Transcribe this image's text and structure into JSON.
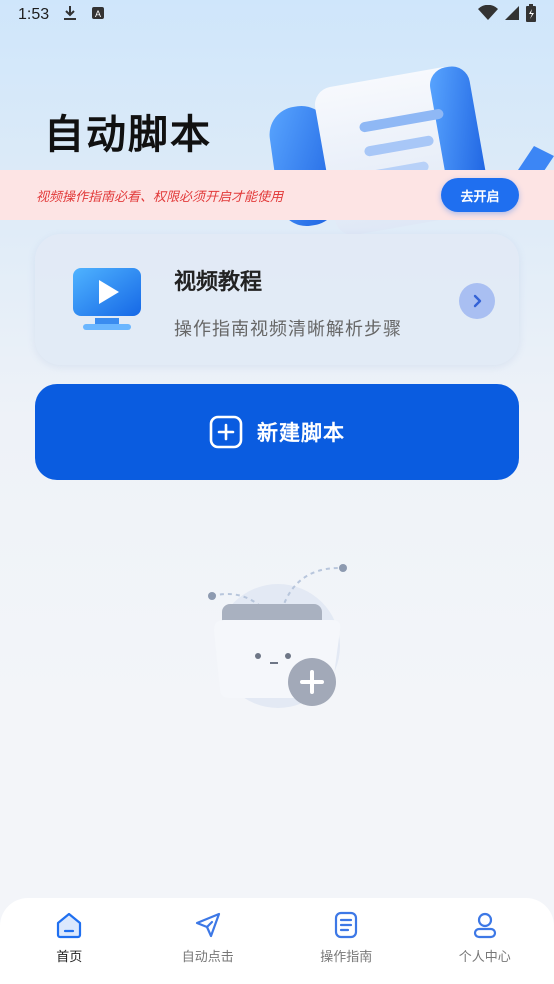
{
  "status_bar": {
    "time": "1:53",
    "icons": [
      "download-icon",
      "keyboard-a-icon",
      "wifi-icon",
      "signal-icon",
      "battery-icon"
    ]
  },
  "hero": {
    "title": "自动脚本"
  },
  "notice": {
    "text": "视频操作指南必看、权限必须开启才能使用",
    "button_label": "去开启"
  },
  "video_card": {
    "title": "视频教程",
    "subtitle": "操作指南视频清晰解析步骤",
    "icon": "video-play-icon"
  },
  "new_script": {
    "label": "新建脚本",
    "icon": "plus-square-icon"
  },
  "bottom_nav": {
    "items": [
      {
        "label": "首页",
        "icon": "home-icon",
        "active": true
      },
      {
        "label": "自动点击",
        "icon": "send-icon",
        "active": false
      },
      {
        "label": "操作指南",
        "icon": "document-icon",
        "active": false
      },
      {
        "label": "个人中心",
        "icon": "user-icon",
        "active": false
      }
    ]
  },
  "colors": {
    "primary": "#0a5ce0",
    "notice_bg": "#fde4e4",
    "notice_text": "#e23a3a",
    "nav_active": "#1f6ff0"
  }
}
